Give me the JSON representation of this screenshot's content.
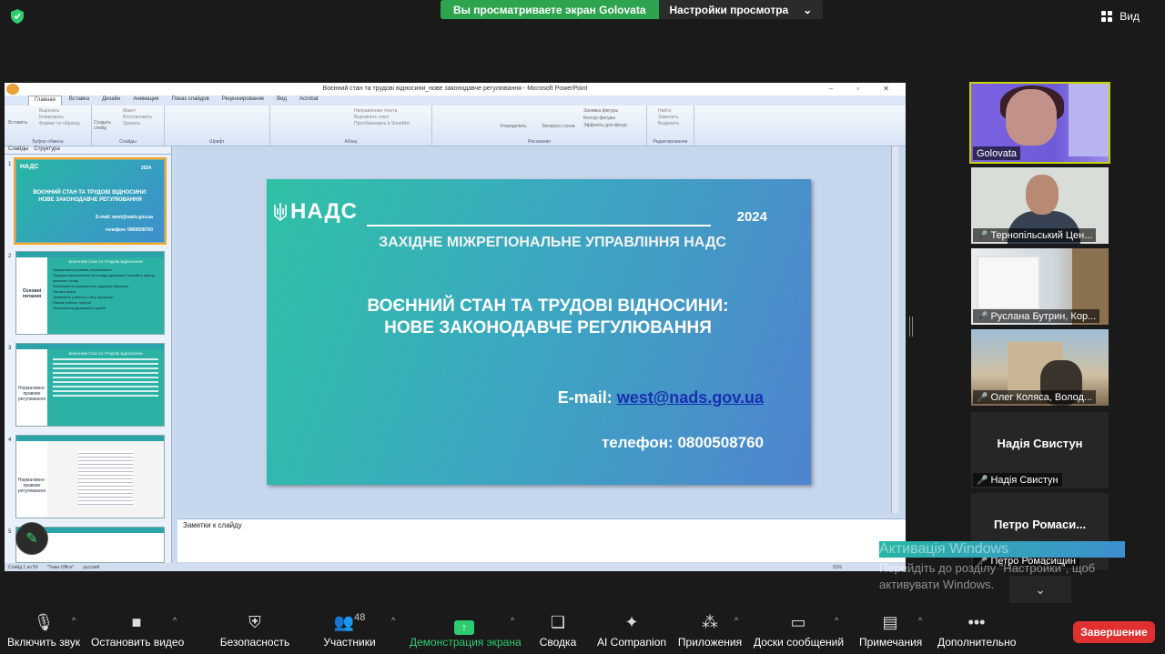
{
  "top": {
    "share_notice": "Вы просматриваете экран Golovata",
    "view_settings": "Настройки просмотра",
    "view_label": "Вид"
  },
  "ppt": {
    "window_title": "Воєнний стан та трудові відносини_нове законодавче регулювання - Microsoft PowerPoint",
    "tabs": [
      "Главная",
      "Вставка",
      "Дизайн",
      "Анимация",
      "Показ слайдов",
      "Рецензирование",
      "Вид",
      "Acrobat"
    ],
    "ribbon_groups": [
      "Буфер обмена",
      "Слайды",
      "Шрифт",
      "Абзац",
      "Рисование",
      "Редактирование"
    ],
    "ribbon_items": {
      "paste": "Вставить",
      "cut": "Вырезать",
      "copy": "Копировать",
      "format_painter": "Формат по образцу",
      "new_slide": "Создать слайд",
      "layout": "Макет",
      "reset": "Восстановить",
      "delete": "Удалить",
      "text_direction": "Направление текста",
      "align_text": "Выровнять текст",
      "smartart": "Преобразовать в SmartArt",
      "arrange": "Упорядочить",
      "quick_styles": "Экспресс-стили",
      "shape_fill": "Заливка фигуры",
      "shape_outline": "Контур фигуры",
      "shape_effects": "Эффекты для фигур",
      "find": "Найти",
      "replace": "Заменить",
      "select": "Выделить"
    },
    "side_tabs": [
      "Слайды",
      "Структура"
    ],
    "thumbnails": [
      {
        "num": "1",
        "org": "НАДС",
        "year": "2024",
        "title": "ВОЄННИЙ СТАН ТА ТРУДОВІ ВІДНОСИНИ: НОВЕ ЗАКОНОДАВЧЕ РЕГУЛЮВАННЯ",
        "email": "E-mail: west@nads.gov.ua",
        "phone": "телефон: 0800508760"
      },
      {
        "num": "2",
        "side_label": "Основні питання",
        "head": "ВОЄННИЙ СТАН ТА ТРУДОВІ ВІДНОСИНИ",
        "items": [
          "Нормативно-правове регулювання",
          "Порядок призначення на посаду державної служби в період воєнного стану",
          "Особливості оформлення трудових відносин",
          "Оплата праці",
          "Тривалість робочого часу, відпустки",
          "Режим роботи, простої",
          "Припинення державної служби"
        ]
      },
      {
        "num": "3",
        "side_label": "Нормативно-правове регулювання",
        "head": "ВОЄННИЙ СТАН ТА ТРУДОВІ ВІДНОСИНИ"
      },
      {
        "num": "4",
        "side_label": "Нормативно-правове регулювання"
      },
      {
        "num": "5"
      }
    ],
    "slide": {
      "logo_text": "НАДС",
      "year": "2024",
      "org": "ЗАХІДНЕ МІЖРЕГІОНАЛЬНЕ УПРАВЛІННЯ НАДС",
      "title_line1": "ВОЄННИЙ СТАН ТА ТРУДОВІ ВІДНОСИНИ:",
      "title_line2": "НОВЕ ЗАКОНОДАВЧЕ РЕГУЛЮВАННЯ",
      "email_label": "E-mail:",
      "email": "west@nads.gov.ua",
      "phone_label": "телефон:",
      "phone": "0800508760"
    },
    "notes_placeholder": "Заметки к слайду",
    "status": {
      "slide": "Слайд 1 из 59",
      "theme": "\"Тема Office\"",
      "lang": "русский",
      "zoom": "91%"
    }
  },
  "participants": [
    {
      "name": "Golovata"
    },
    {
      "name": "Тернопільський Цен..."
    },
    {
      "name": "Руслана Бутрин, Кор..."
    },
    {
      "name": "Олег Коляса, Волод..."
    },
    {
      "name": "Надія Свистун",
      "big": "Надія Свистун"
    },
    {
      "name": "Петро Ромасищин",
      "big": "Петро  Ромаси..."
    }
  ],
  "windows_activation": {
    "title": "Активація Windows",
    "text": "Перейдіть до розділу \"Настройки\", щоб активувати Windows."
  },
  "toolbar": {
    "mute": "Включить звук",
    "video": "Остановить видео",
    "security": "Безопасность",
    "participants": "Участники",
    "participants_count": "48",
    "share": "Демонстрация экрана",
    "whiteboard": "Сводка",
    "ai": "AI Companion",
    "apps": "Приложения",
    "boards": "Доски сообщений",
    "notes": "Примечания",
    "more": "Дополнительно",
    "end": "Завершение"
  },
  "colors": {
    "share_green": "#2ea44f",
    "end_red": "#e0302f",
    "active_speaker": "#c8d400",
    "slide_teal": "#2fc1a5",
    "slide_blue": "#4f84cf"
  }
}
